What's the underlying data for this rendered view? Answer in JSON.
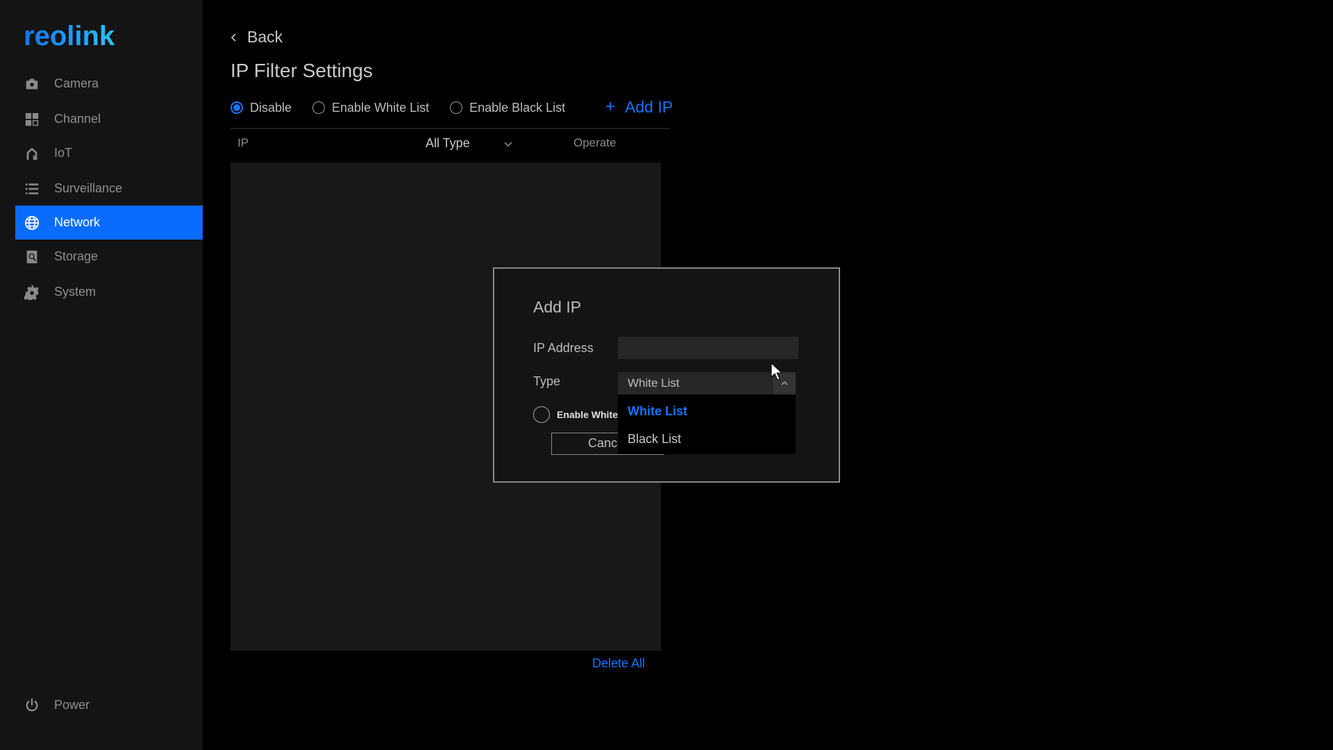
{
  "brand": {
    "logo_text": "reolink",
    "accent_color": "#1673ff"
  },
  "sidebar": {
    "items": [
      {
        "label": "Camera",
        "icon": "camera-icon",
        "active": false
      },
      {
        "label": "Channel",
        "icon": "channel-grid-icon",
        "active": false
      },
      {
        "label": "IoT",
        "icon": "iot-home-icon",
        "active": false
      },
      {
        "label": "Surveillance",
        "icon": "list-icon",
        "active": false
      },
      {
        "label": "Network",
        "icon": "globe-icon",
        "active": true
      },
      {
        "label": "Storage",
        "icon": "storage-disk-icon",
        "active": false
      },
      {
        "label": "System",
        "icon": "gear-icon",
        "active": false
      }
    ],
    "power": {
      "label": "Power",
      "icon": "power-icon"
    }
  },
  "main": {
    "back_label": "Back",
    "title": "IP Filter Settings",
    "filter_mode": {
      "options": [
        "Disable",
        "Enable White List",
        "Enable Black List"
      ],
      "selected": "Disable"
    },
    "add_ip_label": "Add IP",
    "table": {
      "columns": {
        "ip": "IP",
        "type_filter": "All Type",
        "operate": "Operate"
      },
      "rows": []
    },
    "delete_all_label": "Delete All"
  },
  "modal": {
    "title": "Add IP",
    "ip_address_label": "IP Address",
    "ip_address_value": "",
    "type_label": "Type",
    "type_value": "White List",
    "type_options": [
      "White List",
      "Black List"
    ],
    "enable_label": "Enable White",
    "cancel_label": "Cancel"
  }
}
